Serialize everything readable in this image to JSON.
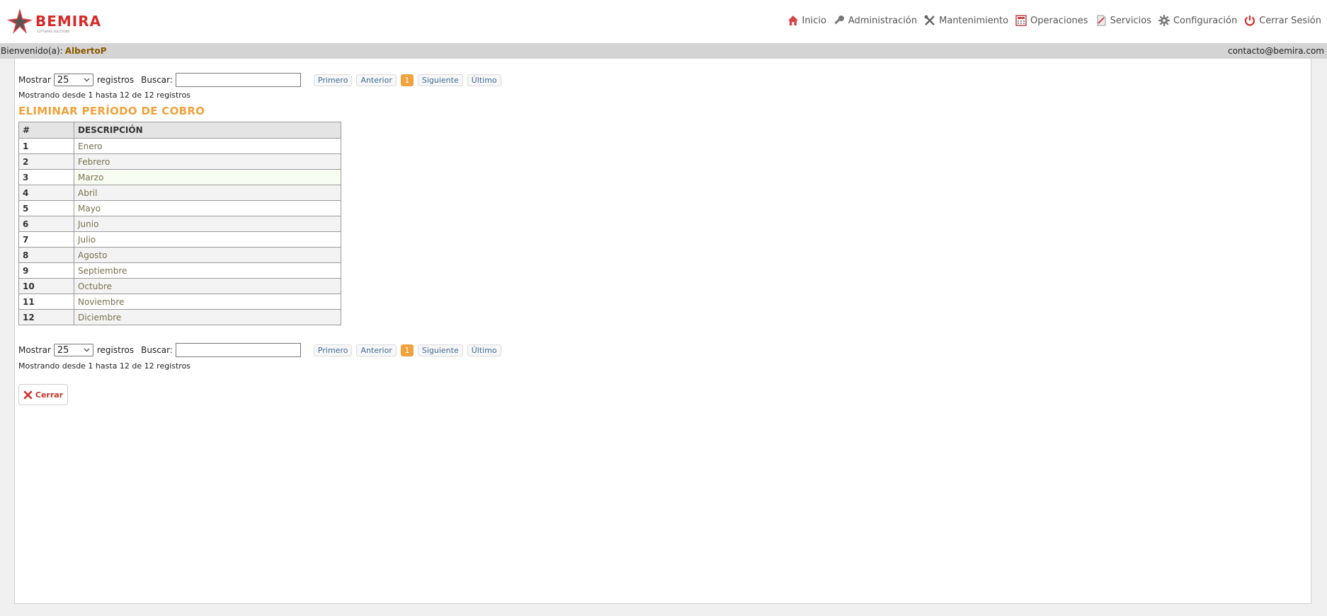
{
  "brand": {
    "name": "BEMIRA",
    "tagline": "SOFTWARE SOLUTIONS",
    "accent": "#d62a2a",
    "highlight": "#f0a23c"
  },
  "nav": {
    "items": [
      {
        "label": "Inicio",
        "icon": "home-icon"
      },
      {
        "label": "Administración",
        "icon": "key-icon"
      },
      {
        "label": "Mantenimiento",
        "icon": "tools-icon"
      },
      {
        "label": "Operaciones",
        "icon": "calculator-icon"
      },
      {
        "label": "Servicios",
        "icon": "document-icon"
      },
      {
        "label": "Configuración",
        "icon": "gear-icon"
      },
      {
        "label": "Cerrar Sesión",
        "icon": "power-icon"
      }
    ]
  },
  "welcome": {
    "label": "Bienvenido(a):",
    "user": "AlbertoP",
    "contact": "contacto@bemira.com"
  },
  "controls": {
    "show_label": "Mostrar",
    "page_size": "25",
    "records_label": "registros",
    "search_label": "Buscar:",
    "search_value": "",
    "first": "Primero",
    "prev": "Anterior",
    "current_page": "1",
    "next": "Siguiente",
    "last": "Último"
  },
  "info": "Mostrando desde 1 hasta 12 de 12 registros",
  "title": "ELIMINAR PERÍODO DE COBRO",
  "table": {
    "headers": [
      "#",
      "DESCRIPCIÓN"
    ],
    "rows": [
      {
        "num": "1",
        "desc": "Enero"
      },
      {
        "num": "2",
        "desc": "Febrero"
      },
      {
        "num": "3",
        "desc": "Marzo"
      },
      {
        "num": "4",
        "desc": "Abril"
      },
      {
        "num": "5",
        "desc": "Mayo"
      },
      {
        "num": "6",
        "desc": "Junio"
      },
      {
        "num": "7",
        "desc": "Julio"
      },
      {
        "num": "8",
        "desc": "Agosto"
      },
      {
        "num": "9",
        "desc": "Septiembre"
      },
      {
        "num": "10",
        "desc": "Octubre"
      },
      {
        "num": "11",
        "desc": "Noviembre"
      },
      {
        "num": "12",
        "desc": "Diciembre"
      }
    ]
  },
  "close_button": {
    "label": "Cerrar",
    "icon": "close-icon"
  }
}
